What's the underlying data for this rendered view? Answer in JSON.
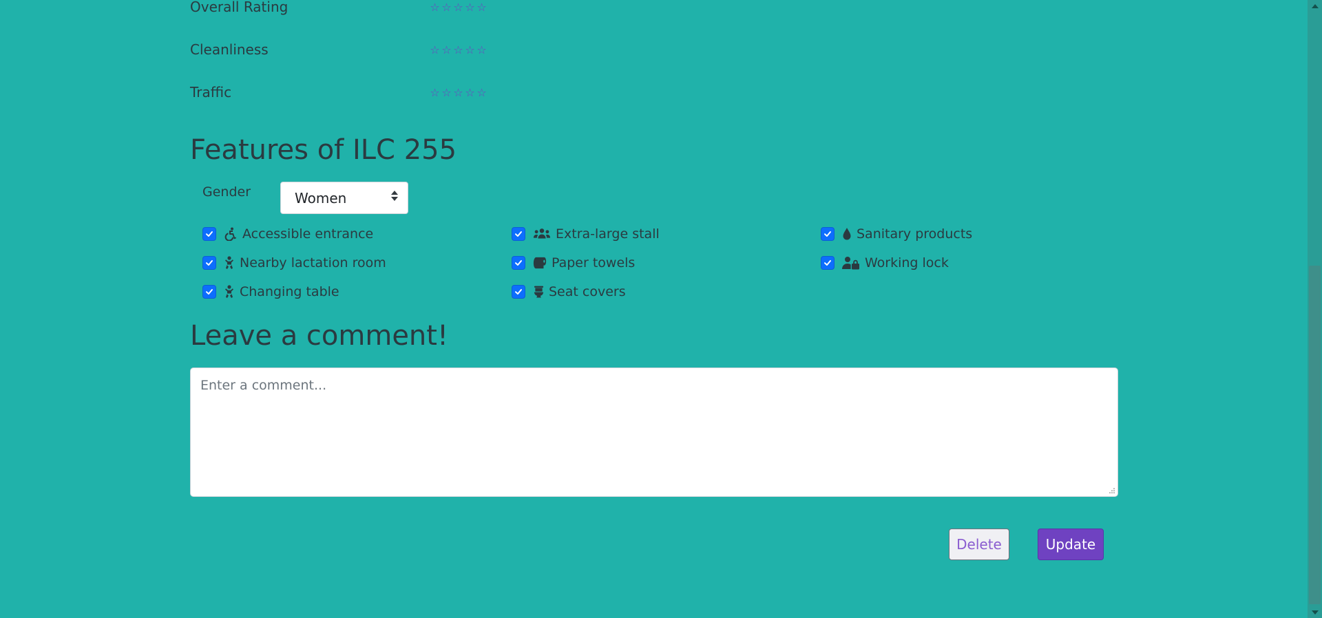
{
  "ratings": [
    {
      "label": "Overall Rating",
      "stars": 5,
      "filled": 0
    },
    {
      "label": "Cleanliness",
      "stars": 5,
      "filled": 0
    },
    {
      "label": "Traffic",
      "stars": 5,
      "filled": 0
    }
  ],
  "star_glyph": "☆",
  "features_title": "Features of ILC 255",
  "gender": {
    "label": "Gender",
    "selected": "Women"
  },
  "features": [
    {
      "label": "Accessible entrance",
      "icon": "wheelchair-icon",
      "checked": true
    },
    {
      "label": "Extra-large stall",
      "icon": "people-group-icon",
      "checked": true
    },
    {
      "label": "Sanitary products",
      "icon": "droplet-icon",
      "checked": true
    },
    {
      "label": "Nearby lactation room",
      "icon": "baby-icon",
      "checked": true
    },
    {
      "label": "Paper towels",
      "icon": "toilet-paper-icon",
      "checked": true
    },
    {
      "label": "Working lock",
      "icon": "user-lock-icon",
      "checked": true
    },
    {
      "label": "Changing table",
      "icon": "baby-icon",
      "checked": true
    },
    {
      "label": "Seat covers",
      "icon": "toilet-icon",
      "checked": true
    }
  ],
  "comment_title": "Leave a comment!",
  "comment": {
    "placeholder": "Enter a comment...",
    "value": ""
  },
  "buttons": {
    "delete": "Delete",
    "update": "Update"
  },
  "colors": {
    "background": "#20b2aa",
    "accent": "#6f42c1",
    "checkbox": "#0d6efd"
  }
}
